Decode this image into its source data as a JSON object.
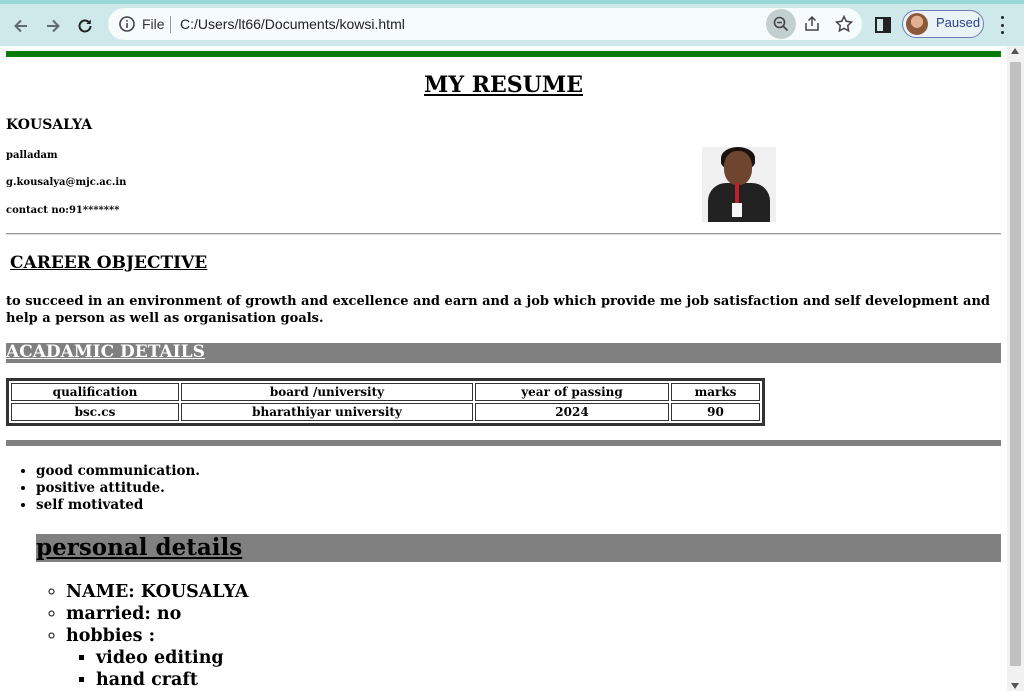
{
  "browser": {
    "file_label": "File",
    "url": "C:/Users/lt66/Documents/kowsi.html",
    "profile_status": "Paused"
  },
  "resume": {
    "title": "MY RESUME",
    "name": "KOUSALYA",
    "location": "palladam",
    "email": "g.kousalya@mjc.ac.in",
    "contact": "contact no:91*******",
    "career_objective_title": "CAREER OBJECTIVE",
    "career_objective_text": "to succeed in an environment of growth and excellence and earn and a job which provide me job satisfaction and self development and help a person as well as organisation goals.",
    "academic_title": "ACADAMIC DETAILS",
    "academic_table": {
      "headers": [
        "qualification",
        "board /university",
        "year of passing",
        "marks"
      ],
      "rows": [
        [
          "bsc.cs",
          "bharathiyar university",
          "2024",
          "90"
        ]
      ]
    },
    "skills": [
      "good communication.",
      "positive attitude.",
      "self motivated"
    ],
    "personal_title": "personal details",
    "personal": {
      "name": "NAME: KOUSALYA",
      "married": "married: no",
      "hobbies_label": "hobbies :",
      "hobbies": [
        "video editing",
        "hand craft"
      ]
    }
  },
  "colors": {
    "top_rule": "#0a7a0a",
    "section_bar": "#808080",
    "chrome_bg": "#cfe9ea"
  },
  "icons": [
    "back-arrow-icon",
    "forward-arrow-icon",
    "reload-icon",
    "info-icon",
    "zoom-out-icon",
    "share-icon",
    "star-icon",
    "side-panel-icon",
    "avatar",
    "menu-icon"
  ]
}
